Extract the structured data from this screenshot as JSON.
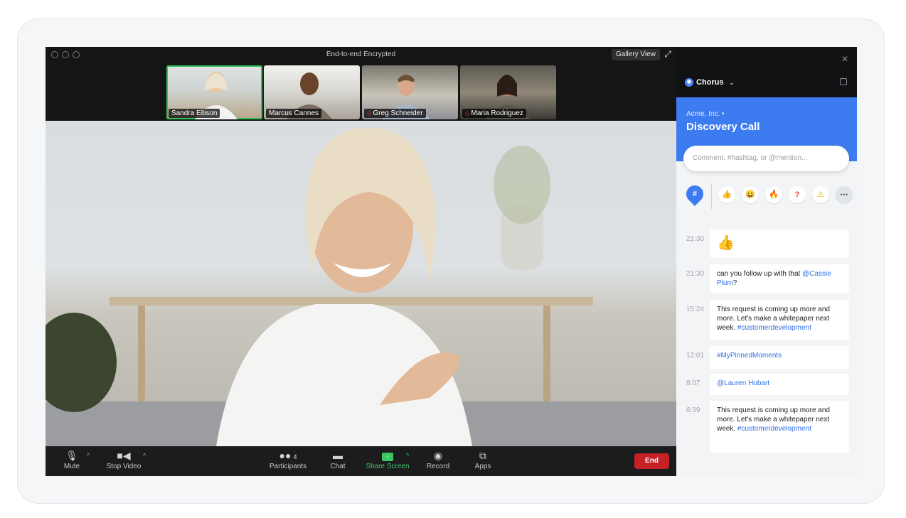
{
  "window": {
    "encryption": "End-to-end Encrypted",
    "gallery_view": "Gallery View"
  },
  "participants": [
    {
      "name": "Sandra Ellison",
      "muted": false,
      "active": true
    },
    {
      "name": "Marcus Cannes",
      "muted": false,
      "active": false
    },
    {
      "name": "Greg Schneider",
      "muted": true,
      "active": false
    },
    {
      "name": "Maria Rodriguez",
      "muted": true,
      "active": false
    }
  ],
  "controls": {
    "mute": "Mute",
    "stop_video": "Stop Video",
    "participants": "Participants",
    "participants_count": "4",
    "chat": "Chat",
    "share_screen": "Share Screen",
    "record": "Record",
    "apps": "Apps",
    "end": "End"
  },
  "chorus": {
    "brand": "Chorus",
    "account": "Acme, Inc. •",
    "title": "Discovery Call",
    "comment_placeholder": "Comment, #hashtag, or @mention...",
    "reactions": [
      "👍",
      "😀",
      "🔥",
      "?",
      "⚠"
    ],
    "feed": [
      {
        "time": "21:30",
        "text": "👍"
      },
      {
        "time": "21:30",
        "text": "can you follow up with that ",
        "tag": "@Cassie Plum",
        "tail": "?"
      },
      {
        "time": "15:24",
        "text": "This request is coming up more and more. Let's make a whitepaper next week. ",
        "tag": "#customerdevelopment"
      },
      {
        "time": "12:01",
        "text": "",
        "tag": "#MyPinnedMoments"
      },
      {
        "time": "8:07",
        "text": "",
        "tag": "@Lauren Hobart"
      },
      {
        "time": "6:39",
        "text": "This request is coming up more and more. Let's make a whitepaper next week. ",
        "tag": "#customerdevelopment"
      }
    ]
  },
  "colors": {
    "accent_blue": "#3d7cf0",
    "end_red": "#c52127",
    "share_green": "#3ec463",
    "active_speaker": "#2fbf56"
  }
}
